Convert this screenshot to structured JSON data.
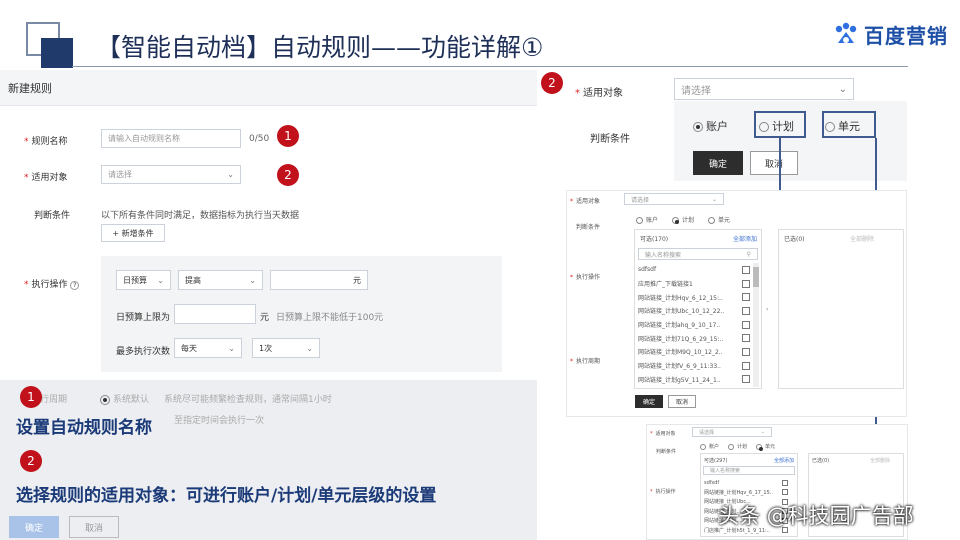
{
  "header": {
    "title": "【智能自动档】自动规则——功能详解①",
    "logo_text": "百度营销",
    "logo_icon": "baidu-paw-icon"
  },
  "left_form": {
    "heading": "新建规则",
    "rule_name_label": "规则名称",
    "rule_name_placeholder": "请输入自动规则名称",
    "rule_name_count": "0/50",
    "target_label": "适用对象",
    "target_placeholder": "请选择",
    "condition_label": "判断条件",
    "condition_desc": "以下所有条件同时满足，数据指标为执行当天数据",
    "add_condition": "+ 新增条件",
    "action_label": "执行操作",
    "action_select1": "日预算",
    "action_select2": "提高",
    "action_unit": "元",
    "budget_limit_label": "日预算上限为",
    "budget_unit": "元",
    "budget_hint": "日预算上限不能低于100元",
    "max_exec_label": "最多执行次数",
    "max_exec_freq": "每天",
    "max_exec_times": "1次",
    "exec_period_label": "行周期",
    "system_default": "系统默认",
    "system_default_desc": "系统尽可能频繁检查规则，通常间隔1小时",
    "specified_desc": "至指定时间会执行一次",
    "confirm": "确定",
    "cancel": "取消",
    "badge1": "1",
    "badge2": "2"
  },
  "notes": {
    "n1_badge": "1",
    "n1_text": "设置自动规则名称",
    "n2_badge": "2",
    "n2_text": "选择规则的适用对象：可进行账户/计划/单元层级的设置"
  },
  "right_panel": {
    "badge": "2",
    "target_label": "适用对象",
    "target_placeholder": "请选择",
    "condition_label": "判断条件",
    "radio_account": "账户",
    "radio_plan": "计划",
    "radio_unit": "单元",
    "confirm": "确定",
    "cancel": "取消"
  },
  "shot2": {
    "target_label": "适用对象",
    "target_placeholder": "请选择",
    "condition_label": "判断条件",
    "radio_account": "账户",
    "radio_plan": "计划",
    "radio_unit": "单元",
    "selectable": "可选(170)",
    "add_all": "全部添加",
    "selected": "已选(0)",
    "delete_all": "全部删除",
    "search_placeholder": "输入名称搜索",
    "action_label": "执行操作",
    "period_label": "执行周期",
    "items": [
      "sdfsdf",
      "应用推广_下载链接1",
      "网站链接_计划Hqv_6_12_15:..",
      "网站链接_计划Ubc_10_12_22..",
      "网站链接_计划ahq_9_10_17..",
      "网站链接_计划71Q_6_29_15:..",
      "网站链接_计划M9Q_10_12_2..",
      "网站链接_计划fV_6_9_11:33..",
      "网站链接_计划g5V_11_24_1.."
    ],
    "confirm": "确定",
    "cancel": "取消"
  },
  "shot3": {
    "target_label": "适用对象",
    "target_placeholder": "请选择",
    "condition_label": "判断条件",
    "radio_account": "账户",
    "radio_plan": "计划",
    "radio_unit": "单元",
    "selectable": "可选(297)",
    "add_all": "全部添加",
    "selected": "已选(0)",
    "delete_all": "全部删除",
    "search_placeholder": "输入名称搜索",
    "action_label": "执行操作",
    "items": [
      "sdfsdf",
      "网站链接_计划Hqv_6_17_15..",
      "网站链接_计划Ubc...",
      "网站链接_计划...",
      "网站链接_计划...",
      "门店推广_计划h5t_1_9_11:.."
    ]
  },
  "watermark": "头条 @科技园广告部"
}
